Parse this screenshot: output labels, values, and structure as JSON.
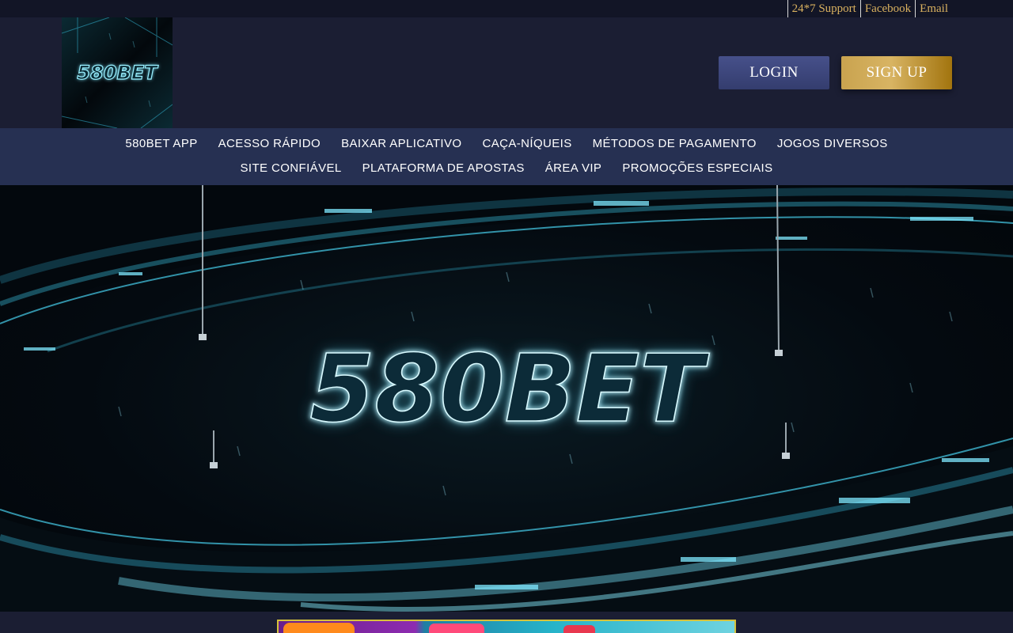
{
  "topbar": {
    "links": [
      "24*7 Support",
      "Facebook",
      "Email"
    ]
  },
  "header": {
    "logo_text": "580BET",
    "login_label": "LOGIN",
    "signup_label": "SIGN UP"
  },
  "nav": {
    "row1": [
      "580BET APP",
      "ACESSO RÁPIDO",
      "BAIXAR APLICATIVO",
      "CAÇA-NÍQUEIS",
      "MÉTODOS DE PAGAMENTO",
      "JOGOS DIVERSOS"
    ],
    "row2": [
      "SITE CONFIÁVEL",
      "PLATAFORMA DE APOSTAS",
      "ÁREA VIP",
      "PROMOÇÕES ESPECIAIS"
    ]
  },
  "hero": {
    "banner_text": "580BET"
  },
  "colors": {
    "background": "#1b1e33",
    "topbar": "#121526",
    "nav": "#263052",
    "gold": "#d9b15f",
    "neon": "#7fe8ff"
  }
}
